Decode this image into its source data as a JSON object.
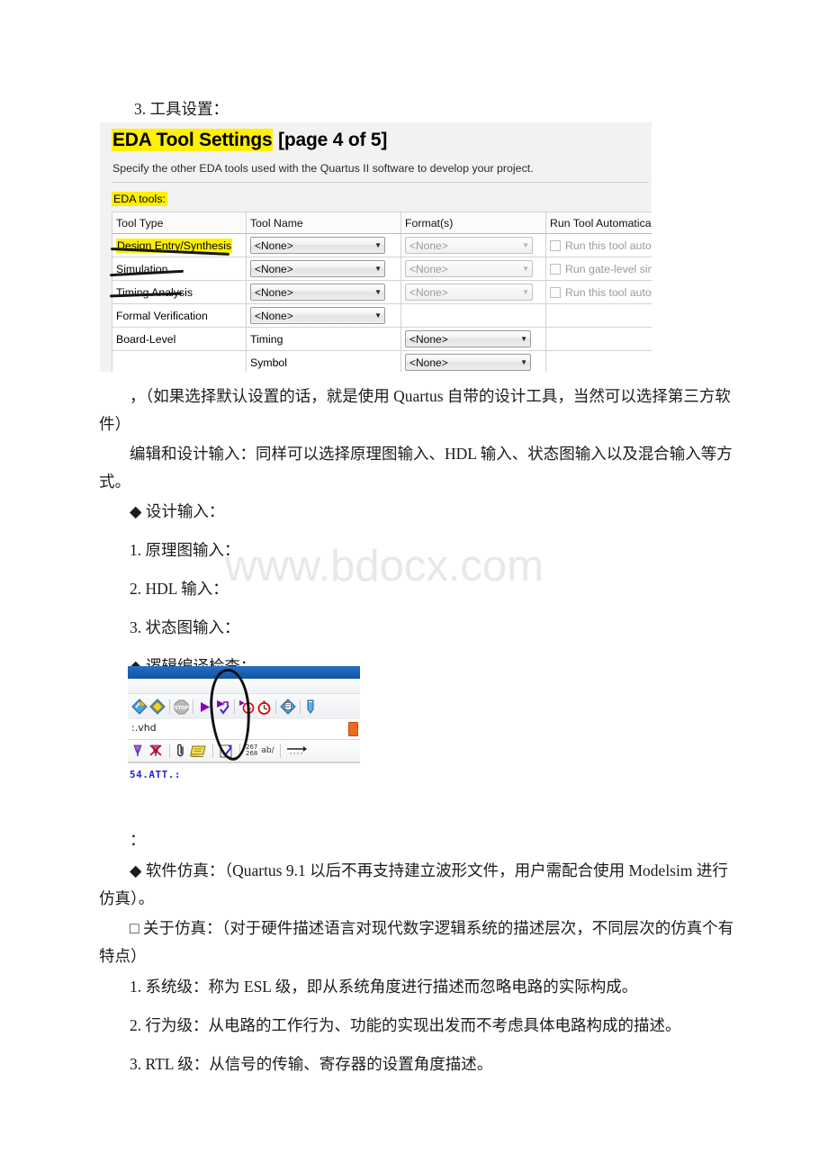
{
  "document": {
    "watermark": "www.bdocx.com",
    "heading_tools": "3. 工具设置：",
    "paragraphs": {
      "p_default_tools": "，（如果选择默认设置的话，就是使用 Quartus 自带的设计工具，当然可以选择第三方软件）",
      "p_edit_input": "编辑和设计输入：同样可以选择原理图输入、HDL 输入、状态图输入以及混合输入等方式。",
      "p_design_input": "◆ 设计输入：",
      "p_schematic": "1. 原理图输入：",
      "p_hdl": "2. HDL 输入：",
      "p_state": "3. 状态图输入：",
      "p_logic_compile": "◆ 逻辑编译检查：",
      "p_colon": "：",
      "p_software_sim": "◆ 软件仿真：（Quartus 9.1 以后不再支持建立波形文件，用户需配合使用 Modelsim 进行仿真）。",
      "p_about_sim": "□ 关于仿真：（对于硬件描述语言对现代数字逻辑系统的描述层次，不同层次的仿真个有特点）",
      "p_level_1": "1. 系统级：称为 ESL 级，即从系统角度进行描述而忽略电路的实际构成。",
      "p_level_2": "2. 行为级：从电路的工作行为、功能的实现出发而不考虑具体电路构成的描述。",
      "p_level_3": "3. RTL 级：从信号的传输、寄存器的设置角度描述。"
    }
  },
  "eda_dialog": {
    "title_highlight": "EDA Tool Settings",
    "title_rest": " [page 4 of 5]",
    "subtitle": "Specify the other EDA tools used with the Quartus II software to develop your project.",
    "tools_label": "EDA tools:",
    "columns": [
      "Tool Type",
      "Tool Name",
      "Format(s)",
      "Run Tool Automatically"
    ],
    "rows": [
      {
        "tool_type": "Design Entry/Synthesis",
        "highlight": true,
        "tool_name": "<None>",
        "tool_name_kind": "combo",
        "format": "<None>",
        "format_kind": "combo-disabled",
        "auto": "Run this tool automat",
        "auto_kind": "checkbox"
      },
      {
        "tool_type": "Simulation",
        "highlight": false,
        "tool_name": "<None>",
        "tool_name_kind": "combo",
        "format": "<None>",
        "format_kind": "combo-disabled",
        "auto": "Run gate-level simula",
        "auto_kind": "checkbox"
      },
      {
        "tool_type": "Timing Analysis",
        "highlight": false,
        "tool_name": "<None>",
        "tool_name_kind": "combo",
        "format": "<None>",
        "format_kind": "combo-disabled",
        "auto": "Run this tool automat",
        "auto_kind": "checkbox"
      },
      {
        "tool_type": "Formal Verification",
        "highlight": false,
        "tool_name": "<None>",
        "tool_name_kind": "combo",
        "format": "",
        "format_kind": "empty",
        "auto": "",
        "auto_kind": "empty"
      },
      {
        "tool_type": "Board-Level",
        "highlight": false,
        "tool_name": "Timing",
        "tool_name_kind": "text",
        "format": "<None>",
        "format_kind": "combo",
        "auto": "",
        "auto_kind": "empty"
      },
      {
        "tool_type": "",
        "highlight": false,
        "tool_name": "Symbol",
        "tool_name_kind": "text",
        "format": "<None>",
        "format_kind": "combo",
        "auto": "",
        "auto_kind": "empty"
      }
    ]
  },
  "quartus_toolbar": {
    "tab_label": ":.vhd",
    "code_label": "54.ATT.:",
    "counter_top": "267",
    "counter_bottom": "268",
    "ab_label": "ab/",
    "annotation": "hand-drawn-circle around start-compilation button",
    "icons_row1": [
      "analyze-synthesis-icon",
      "compile-design-icon",
      "stop-icon",
      "start-compilation-icon",
      "start-analysis-elaboration-icon",
      "start-timing-analysis-icon",
      "timing-analyzer-icon",
      "report-icon",
      "programmer-icon"
    ],
    "icons_row2": [
      "insert-pin-icon",
      "delete-pin-icon",
      "paperclip-icon",
      "note-icon",
      "check-document-icon",
      "line-counter-icon",
      "find-text-icon",
      "arrow-icon"
    ]
  },
  "colors": {
    "highlight_yellow": "#ffef00",
    "titlebar_blue": "#1760b4",
    "code_blue": "#2323e0",
    "accent_orange": "#f06a1e",
    "annotation_black": "#111111"
  }
}
